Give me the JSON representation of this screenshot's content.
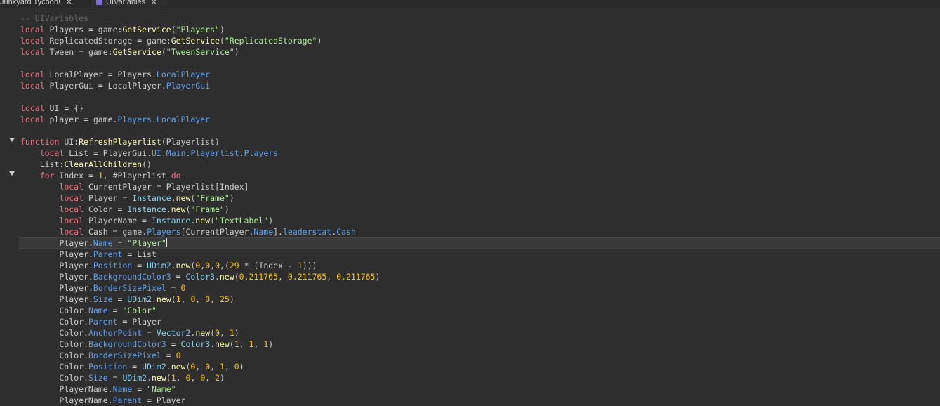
{
  "tabs": [
    {
      "label": "Junkyard Tycoon!",
      "active": false
    },
    {
      "label": "UIVariables",
      "active": true
    }
  ],
  "editor": {
    "folded_lines": [
      11,
      14
    ],
    "current_line": 20,
    "lines": [
      [
        [
          "comment",
          "-- UIVariables"
        ]
      ],
      [
        [
          "kw",
          "local"
        ],
        [
          "id",
          " Players "
        ],
        [
          "op",
          "="
        ],
        [
          "id",
          " game"
        ],
        [
          "op",
          ":"
        ],
        [
          "fn",
          "GetService"
        ],
        [
          "op",
          "("
        ],
        [
          "str",
          "\"Players\""
        ],
        [
          "op",
          ")"
        ]
      ],
      [
        [
          "kw",
          "local"
        ],
        [
          "id",
          " ReplicatedStorage "
        ],
        [
          "op",
          "="
        ],
        [
          "id",
          " game"
        ],
        [
          "op",
          ":"
        ],
        [
          "fn",
          "GetService"
        ],
        [
          "op",
          "("
        ],
        [
          "str",
          "\"ReplicatedStorage\""
        ],
        [
          "op",
          ")"
        ]
      ],
      [
        [
          "kw",
          "local"
        ],
        [
          "id",
          " Tween "
        ],
        [
          "op",
          "="
        ],
        [
          "id",
          " game"
        ],
        [
          "op",
          ":"
        ],
        [
          "fn",
          "GetService"
        ],
        [
          "op",
          "("
        ],
        [
          "str",
          "\"TweenService\""
        ],
        [
          "op",
          ")"
        ]
      ],
      [],
      [
        [
          "kw",
          "local"
        ],
        [
          "id",
          " LocalPlayer "
        ],
        [
          "op",
          "="
        ],
        [
          "id",
          " Players"
        ],
        [
          "op",
          "."
        ],
        [
          "prop",
          "LocalPlayer"
        ]
      ],
      [
        [
          "kw",
          "local"
        ],
        [
          "id",
          " PlayerGui "
        ],
        [
          "op",
          "="
        ],
        [
          "id",
          " LocalPlayer"
        ],
        [
          "op",
          "."
        ],
        [
          "prop",
          "PlayerGui"
        ]
      ],
      [],
      [
        [
          "kw",
          "local"
        ],
        [
          "id",
          " UI "
        ],
        [
          "op",
          "="
        ],
        [
          "id",
          " {}"
        ]
      ],
      [
        [
          "kw",
          "local"
        ],
        [
          "id",
          " player "
        ],
        [
          "op",
          "="
        ],
        [
          "id",
          " game"
        ],
        [
          "op",
          "."
        ],
        [
          "prop",
          "Players"
        ],
        [
          "op",
          "."
        ],
        [
          "prop",
          "LocalPlayer"
        ]
      ],
      [],
      [
        [
          "kw",
          "function"
        ],
        [
          "id",
          " UI"
        ],
        [
          "op",
          ":"
        ],
        [
          "fn",
          "RefreshPlayerlist"
        ],
        [
          "op",
          "("
        ],
        [
          "id",
          "Playerlist"
        ],
        [
          "op",
          ")"
        ]
      ],
      [
        [
          "id",
          "    "
        ],
        [
          "kw",
          "local"
        ],
        [
          "id",
          " List "
        ],
        [
          "op",
          "="
        ],
        [
          "id",
          " PlayerGui"
        ],
        [
          "op",
          "."
        ],
        [
          "prop",
          "UI"
        ],
        [
          "op",
          "."
        ],
        [
          "prop",
          "Main"
        ],
        [
          "op",
          "."
        ],
        [
          "prop",
          "Playerlist"
        ],
        [
          "op",
          "."
        ],
        [
          "prop",
          "Players"
        ]
      ],
      [
        [
          "id",
          "    List"
        ],
        [
          "op",
          ":"
        ],
        [
          "fn",
          "ClearAllChildren"
        ],
        [
          "op",
          "()"
        ]
      ],
      [
        [
          "id",
          "    "
        ],
        [
          "kw",
          "for"
        ],
        [
          "id",
          " Index "
        ],
        [
          "op",
          "="
        ],
        [
          "num",
          " 1"
        ],
        [
          "op",
          ","
        ],
        [
          "id",
          " #Playerlist "
        ],
        [
          "kw",
          "do"
        ]
      ],
      [
        [
          "id",
          "        "
        ],
        [
          "kw",
          "local"
        ],
        [
          "id",
          " CurrentPlayer "
        ],
        [
          "op",
          "="
        ],
        [
          "id",
          " Playerlist[Index]"
        ]
      ],
      [
        [
          "id",
          "        "
        ],
        [
          "kw",
          "local"
        ],
        [
          "id",
          " Player "
        ],
        [
          "op",
          "="
        ],
        [
          "builtin",
          " Instance"
        ],
        [
          "op",
          "."
        ],
        [
          "fn",
          "new"
        ],
        [
          "op",
          "("
        ],
        [
          "str",
          "\"Frame\""
        ],
        [
          "op",
          ")"
        ]
      ],
      [
        [
          "id",
          "        "
        ],
        [
          "kw",
          "local"
        ],
        [
          "id",
          " Color "
        ],
        [
          "op",
          "="
        ],
        [
          "builtin",
          " Instance"
        ],
        [
          "op",
          "."
        ],
        [
          "fn",
          "new"
        ],
        [
          "op",
          "("
        ],
        [
          "str",
          "\"Frame\""
        ],
        [
          "op",
          ")"
        ]
      ],
      [
        [
          "id",
          "        "
        ],
        [
          "kw",
          "local"
        ],
        [
          "id",
          " PlayerName "
        ],
        [
          "op",
          "="
        ],
        [
          "builtin",
          " Instance"
        ],
        [
          "op",
          "."
        ],
        [
          "fn",
          "new"
        ],
        [
          "op",
          "("
        ],
        [
          "str",
          "\"TextLabel\""
        ],
        [
          "op",
          ")"
        ]
      ],
      [
        [
          "id",
          "        "
        ],
        [
          "kw",
          "local"
        ],
        [
          "id",
          " Cash "
        ],
        [
          "op",
          "="
        ],
        [
          "id",
          " game"
        ],
        [
          "op",
          "."
        ],
        [
          "prop",
          "Players"
        ],
        [
          "op",
          "["
        ],
        [
          "id",
          "CurrentPlayer"
        ],
        [
          "op",
          "."
        ],
        [
          "prop",
          "Name"
        ],
        [
          "op",
          "]."
        ],
        [
          "prop",
          "leaderstat"
        ],
        [
          "op",
          "."
        ],
        [
          "prop",
          "Cash"
        ]
      ],
      [
        [
          "id",
          "        Player"
        ],
        [
          "op",
          "."
        ],
        [
          "prop",
          "Name"
        ],
        [
          "op",
          " ="
        ],
        [
          "str",
          " \"Player\""
        ]
      ],
      [
        [
          "id",
          "        Player"
        ],
        [
          "op",
          "."
        ],
        [
          "prop",
          "Parent"
        ],
        [
          "op",
          " ="
        ],
        [
          "id",
          " List"
        ]
      ],
      [
        [
          "id",
          "        Player"
        ],
        [
          "op",
          "."
        ],
        [
          "prop",
          "Position"
        ],
        [
          "op",
          " ="
        ],
        [
          "builtin",
          " UDim2"
        ],
        [
          "op",
          "."
        ],
        [
          "fn",
          "new"
        ],
        [
          "op",
          "("
        ],
        [
          "num",
          "0"
        ],
        [
          "op",
          ","
        ],
        [
          "num",
          "0"
        ],
        [
          "op",
          ","
        ],
        [
          "num",
          "0"
        ],
        [
          "op",
          ",("
        ],
        [
          "num",
          "29"
        ],
        [
          "op",
          " * ("
        ],
        [
          "id",
          "Index"
        ],
        [
          "op",
          " - "
        ],
        [
          "num",
          "1"
        ],
        [
          "op",
          ")))"
        ]
      ],
      [
        [
          "id",
          "        Player"
        ],
        [
          "op",
          "."
        ],
        [
          "prop",
          "BackgroundColor3"
        ],
        [
          "op",
          " ="
        ],
        [
          "builtin",
          " Color3"
        ],
        [
          "op",
          "."
        ],
        [
          "fn",
          "new"
        ],
        [
          "op",
          "("
        ],
        [
          "num",
          "0.211765"
        ],
        [
          "op",
          ", "
        ],
        [
          "num",
          "0.211765"
        ],
        [
          "op",
          ", "
        ],
        [
          "num",
          "0.211765"
        ],
        [
          "op",
          ")"
        ]
      ],
      [
        [
          "id",
          "        Player"
        ],
        [
          "op",
          "."
        ],
        [
          "prop",
          "BorderSizePixel"
        ],
        [
          "op",
          " ="
        ],
        [
          "num",
          " 0"
        ]
      ],
      [
        [
          "id",
          "        Player"
        ],
        [
          "op",
          "."
        ],
        [
          "prop",
          "Size"
        ],
        [
          "op",
          " ="
        ],
        [
          "builtin",
          " UDim2"
        ],
        [
          "op",
          "."
        ],
        [
          "fn",
          "new"
        ],
        [
          "op",
          "("
        ],
        [
          "num",
          "1"
        ],
        [
          "op",
          ", "
        ],
        [
          "num",
          "0"
        ],
        [
          "op",
          ", "
        ],
        [
          "num",
          "0"
        ],
        [
          "op",
          ", "
        ],
        [
          "num",
          "25"
        ],
        [
          "op",
          ")"
        ]
      ],
      [
        [
          "id",
          "        Color"
        ],
        [
          "op",
          "."
        ],
        [
          "prop",
          "Name"
        ],
        [
          "op",
          " ="
        ],
        [
          "str",
          " \"Color\""
        ]
      ],
      [
        [
          "id",
          "        Color"
        ],
        [
          "op",
          "."
        ],
        [
          "prop",
          "Parent"
        ],
        [
          "op",
          " ="
        ],
        [
          "id",
          " Player"
        ]
      ],
      [
        [
          "id",
          "        Color"
        ],
        [
          "op",
          "."
        ],
        [
          "prop",
          "AnchorPoint"
        ],
        [
          "op",
          " ="
        ],
        [
          "builtin",
          " Vector2"
        ],
        [
          "op",
          "."
        ],
        [
          "fn",
          "new"
        ],
        [
          "op",
          "("
        ],
        [
          "num",
          "0"
        ],
        [
          "op",
          ", "
        ],
        [
          "num",
          "1"
        ],
        [
          "op",
          ")"
        ]
      ],
      [
        [
          "id",
          "        Color"
        ],
        [
          "op",
          "."
        ],
        [
          "prop",
          "BackgroundColor3"
        ],
        [
          "op",
          " ="
        ],
        [
          "builtin",
          " Color3"
        ],
        [
          "op",
          "."
        ],
        [
          "fn",
          "new"
        ],
        [
          "op",
          "("
        ],
        [
          "num",
          "1"
        ],
        [
          "op",
          ", "
        ],
        [
          "num",
          "1"
        ],
        [
          "op",
          ", "
        ],
        [
          "num",
          "1"
        ],
        [
          "op",
          ")"
        ]
      ],
      [
        [
          "id",
          "        Color"
        ],
        [
          "op",
          "."
        ],
        [
          "prop",
          "BorderSizePixel"
        ],
        [
          "op",
          " ="
        ],
        [
          "num",
          " 0"
        ]
      ],
      [
        [
          "id",
          "        Color"
        ],
        [
          "op",
          "."
        ],
        [
          "prop",
          "Position"
        ],
        [
          "op",
          " ="
        ],
        [
          "builtin",
          " UDim2"
        ],
        [
          "op",
          "."
        ],
        [
          "fn",
          "new"
        ],
        [
          "op",
          "("
        ],
        [
          "num",
          "0"
        ],
        [
          "op",
          ", "
        ],
        [
          "num",
          "0"
        ],
        [
          "op",
          ", "
        ],
        [
          "num",
          "1"
        ],
        [
          "op",
          ", "
        ],
        [
          "num",
          "0"
        ],
        [
          "op",
          ")"
        ]
      ],
      [
        [
          "id",
          "        Color"
        ],
        [
          "op",
          "."
        ],
        [
          "prop",
          "Size"
        ],
        [
          "op",
          " ="
        ],
        [
          "builtin",
          " UDim2"
        ],
        [
          "op",
          "."
        ],
        [
          "fn",
          "new"
        ],
        [
          "op",
          "("
        ],
        [
          "num",
          "1"
        ],
        [
          "op",
          ", "
        ],
        [
          "num",
          "0"
        ],
        [
          "op",
          ", "
        ],
        [
          "num",
          "0"
        ],
        [
          "op",
          ", "
        ],
        [
          "num",
          "2"
        ],
        [
          "op",
          ")"
        ]
      ],
      [
        [
          "id",
          "        PlayerName"
        ],
        [
          "op",
          "."
        ],
        [
          "prop",
          "Name"
        ],
        [
          "op",
          " ="
        ],
        [
          "str",
          " \"Name\""
        ]
      ],
      [
        [
          "id",
          "        PlayerName"
        ],
        [
          "op",
          "."
        ],
        [
          "prop",
          "Parent"
        ],
        [
          "op",
          " ="
        ],
        [
          "id",
          " Player"
        ]
      ]
    ]
  },
  "colors": {
    "background": "#2e2e2e",
    "keyword": "#f86d7c",
    "string": "#adf195",
    "number": "#ffc600",
    "property": "#61a1f1",
    "method": "#fdfbac",
    "comment": "#666666"
  }
}
